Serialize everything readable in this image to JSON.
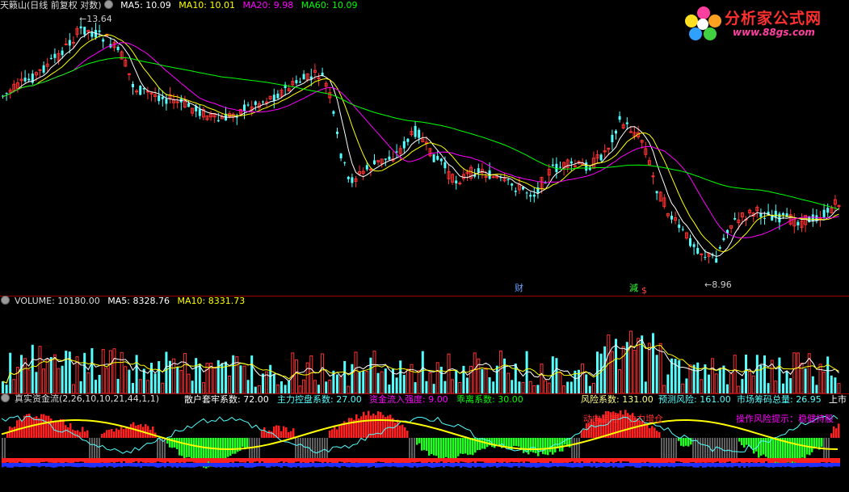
{
  "price_pane": {
    "title_prefix": "天籁山(日线 前复权 对数)",
    "ma5": "MA5: 10.09",
    "ma10": "MA10: 10.01",
    "ma20": "MA20: 9.98",
    "ma60": "MA60: 10.09",
    "high_marker": "13.64",
    "low_marker": "8.96",
    "event_cai": "财",
    "event_jian": "減",
    "event_s": "$",
    "colors": {
      "ma5": "#ffffff",
      "ma10": "#ffff00",
      "ma20": "#ff00ff",
      "ma60": "#00ff00",
      "up": "#ff3232",
      "down": "#54ffff"
    }
  },
  "volume_pane": {
    "volume": "VOLUME: 10180.00",
    "ma5": "MA5: 8328.76",
    "ma10": "MA10: 8331.73"
  },
  "flow_pane": {
    "title": "真实资金流(2,26,10,10,21,44,1,1)",
    "retail": "散户套牢系数: 72.00",
    "control": "主力控盘系数: 27.00",
    "inflow": "资金流入强度: 9.00",
    "deviation": "乖离系数: 30.00",
    "risk": "风险系数: 131.00",
    "forecast_risk": "预测风险: 161.00",
    "chips": "市场筹码总量: 26.95",
    "listed": "上市",
    "monitor": "动向监控：主力增仓",
    "hint": "操作风险提示：稳健持股"
  },
  "logo": {
    "brand": "分析家公式网",
    "url": "www.88gs.com"
  }
}
